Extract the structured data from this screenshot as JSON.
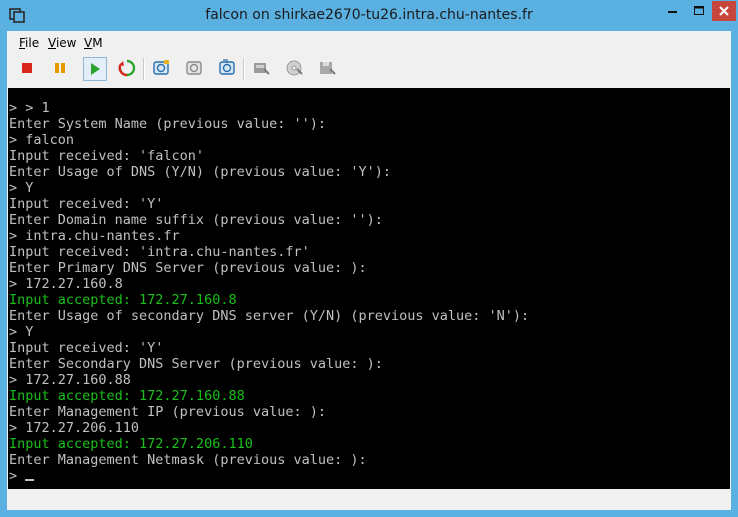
{
  "window": {
    "title": "falcon on shirkae2670-tu26.intra.chu-nantes.fr"
  },
  "menu": [
    {
      "accel": "F",
      "rest": "ile"
    },
    {
      "accel": "V",
      "rest": "iew"
    },
    {
      "accel": "V",
      "rest": "M"
    }
  ],
  "toolbar_icons": [
    "stop-icon",
    "pause-icon",
    "play-icon",
    "reset-icon",
    "snapshot-take-icon",
    "snapshot-revert-icon",
    "snapshot-manager-icon",
    "disk-icon",
    "cd-icon",
    "floppy-icon"
  ],
  "colors": {
    "console_text": "#c0c0c0",
    "console_accepted": "#19c019",
    "console_bg": "#000000",
    "titlebar": "#5ab0e0",
    "close_button": "#c7463b"
  },
  "console": {
    "lines": [
      {
        "text": "> > 1",
        "style": "normal"
      },
      {
        "text": "Enter System Name (previous value: ''):",
        "style": "normal"
      },
      {
        "text": "> falcon",
        "style": "normal"
      },
      {
        "text": "Input received: 'falcon'",
        "style": "normal"
      },
      {
        "text": "Enter Usage of DNS (Y/N) (previous value: 'Y'):",
        "style": "normal"
      },
      {
        "text": "> Y",
        "style": "normal"
      },
      {
        "text": "Input received: 'Y'",
        "style": "normal"
      },
      {
        "text": "Enter Domain name suffix (previous value: ''):",
        "style": "normal"
      },
      {
        "text": "> intra.chu-nantes.fr",
        "style": "normal"
      },
      {
        "text": "Input received: 'intra.chu-nantes.fr'",
        "style": "normal"
      },
      {
        "text": "Enter Primary DNS Server (previous value: ):",
        "style": "normal"
      },
      {
        "text": "> 172.27.160.8",
        "style": "normal"
      },
      {
        "text": "Input accepted: 172.27.160.8",
        "style": "green"
      },
      {
        "text": "Enter Usage of secondary DNS server (Y/N) (previous value: 'N'):",
        "style": "normal"
      },
      {
        "text": "> Y",
        "style": "normal"
      },
      {
        "text": "Input received: 'Y'",
        "style": "normal"
      },
      {
        "text": "Enter Secondary DNS Server (previous value: ):",
        "style": "normal"
      },
      {
        "text": "> 172.27.160.88",
        "style": "normal"
      },
      {
        "text": "Input accepted: 172.27.160.88",
        "style": "green"
      },
      {
        "text": "Enter Management IP (previous value: ):",
        "style": "normal"
      },
      {
        "text": "> 172.27.206.110",
        "style": "normal"
      },
      {
        "text": "Input accepted: 172.27.206.110",
        "style": "green"
      },
      {
        "text": "Enter Management Netmask (previous value: ):",
        "style": "normal"
      },
      {
        "text": "> ",
        "style": "prompt"
      }
    ]
  }
}
